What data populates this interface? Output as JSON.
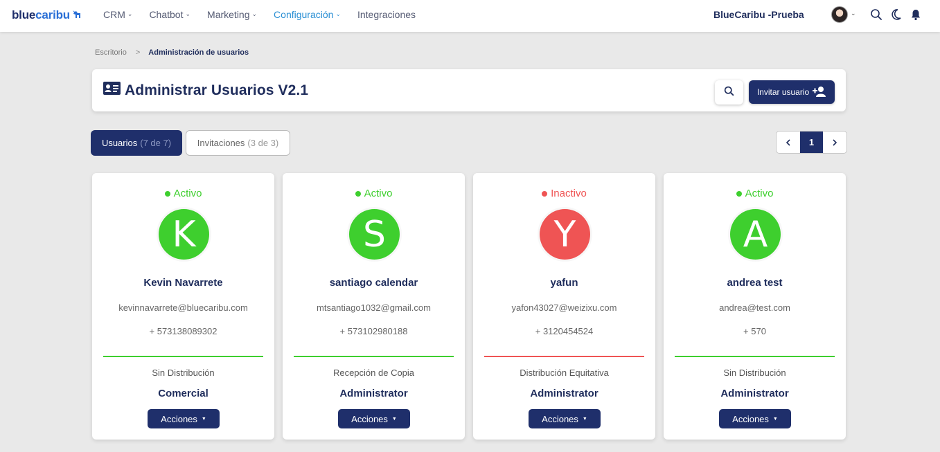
{
  "brand": {
    "part1": "blue",
    "part2": "caribu"
  },
  "nav": [
    {
      "label": "CRM",
      "active": false,
      "dropdown": true
    },
    {
      "label": "Chatbot",
      "active": false,
      "dropdown": true
    },
    {
      "label": "Marketing",
      "active": false,
      "dropdown": true
    },
    {
      "label": "Configuración",
      "active": true,
      "dropdown": true
    },
    {
      "label": "Integraciones",
      "active": false,
      "dropdown": false
    }
  ],
  "company": "BlueCaribu -Prueba",
  "breadcrumb": {
    "root": "Escritorio",
    "separator": ">",
    "current": "Administración de usuarios"
  },
  "header": {
    "title": "Administrar Usuarios V2.1",
    "invite_label": "Invitar usuario"
  },
  "tabs": {
    "users": {
      "label": "Usuarios",
      "count": "(7 de 7)"
    },
    "invites": {
      "label": "Invitaciones",
      "count": "(3 de 3)"
    }
  },
  "pagination": {
    "prev": "‹",
    "current": "1",
    "next": "›"
  },
  "colors": {
    "active": "#3ecf2e",
    "inactive": "#ef5454",
    "primary": "#1f2f6b"
  },
  "users": [
    {
      "status": "Activo",
      "state": "active",
      "initial": "K",
      "name": "Kevin Navarrete",
      "email": "kevinnavarrete@bluecaribu.com",
      "phone": "+ 573138089302",
      "distribution": "Sin Distribución",
      "role": "Comercial",
      "actions": "Acciones"
    },
    {
      "status": "Activo",
      "state": "active",
      "initial": "S",
      "name": "santiago calendar",
      "email": "mtsantiago1032@gmail.com",
      "phone": "+ 573102980188",
      "distribution": "Recepción de Copia",
      "role": "Administrator",
      "actions": "Acciones"
    },
    {
      "status": "Inactivo",
      "state": "inactive",
      "initial": "Y",
      "name": "yafun",
      "email": "yafon43027@weizixu.com",
      "phone": "+ 3120454524",
      "distribution": "Distribución Equitativa",
      "role": "Administrator",
      "actions": "Acciones"
    },
    {
      "status": "Activo",
      "state": "active",
      "initial": "A",
      "name": "andrea test",
      "email": "andrea@test.com",
      "phone": "+ 570",
      "distribution": "Sin Distribución",
      "role": "Administrator",
      "actions": "Acciones"
    }
  ]
}
